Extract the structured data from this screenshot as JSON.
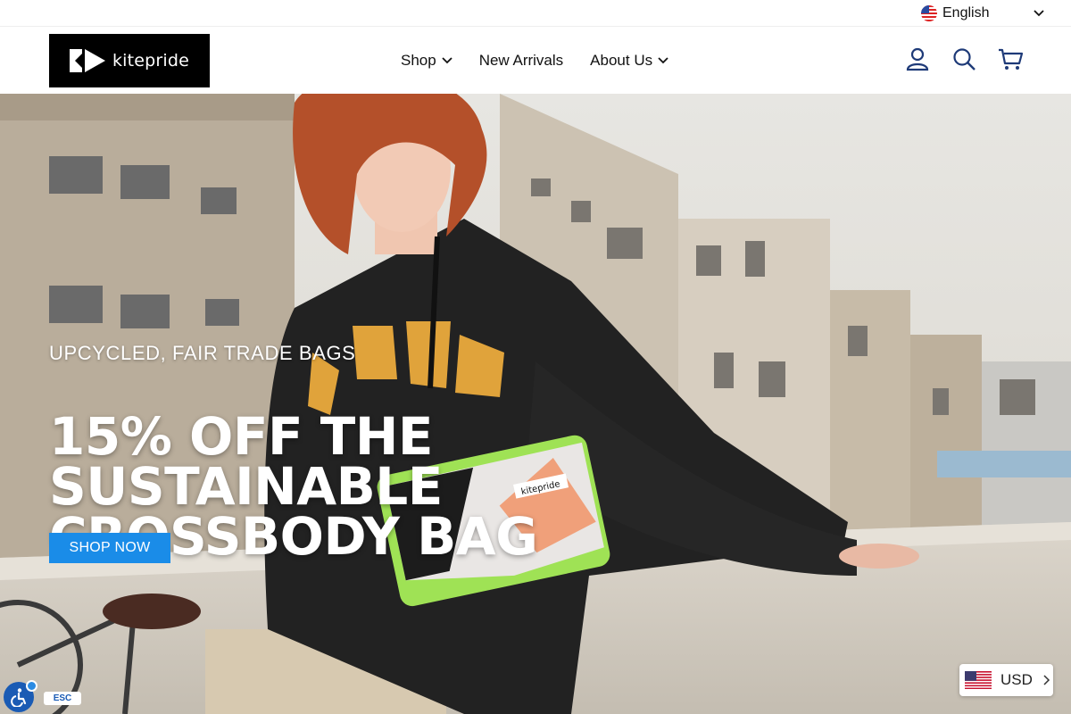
{
  "topbar": {
    "language": "English",
    "language_flag_icon": "us-flag-icon"
  },
  "header": {
    "logo_text": "kitepride",
    "nav": [
      {
        "label": "Shop",
        "has_dropdown": true
      },
      {
        "label": "New Arrivals",
        "has_dropdown": false
      },
      {
        "label": "About Us",
        "has_dropdown": true
      }
    ],
    "icons": [
      "account-icon",
      "search-icon",
      "cart-icon"
    ]
  },
  "hero": {
    "subtitle": "UPCYCLED, FAIR TRADE BAGS",
    "title": "15% OFF THE SUSTAINABLE CROSSBODY BAG",
    "cta_label": "SHOP NOW",
    "bag_label": "kitepride"
  },
  "widgets": {
    "esc_label": "ESC",
    "currency": "USD",
    "accessibility_icon": "accessibility-icon"
  },
  "colors": {
    "accent": "#1a8ce8",
    "logo_bg": "#000000",
    "bag_green": "#9fe255"
  }
}
